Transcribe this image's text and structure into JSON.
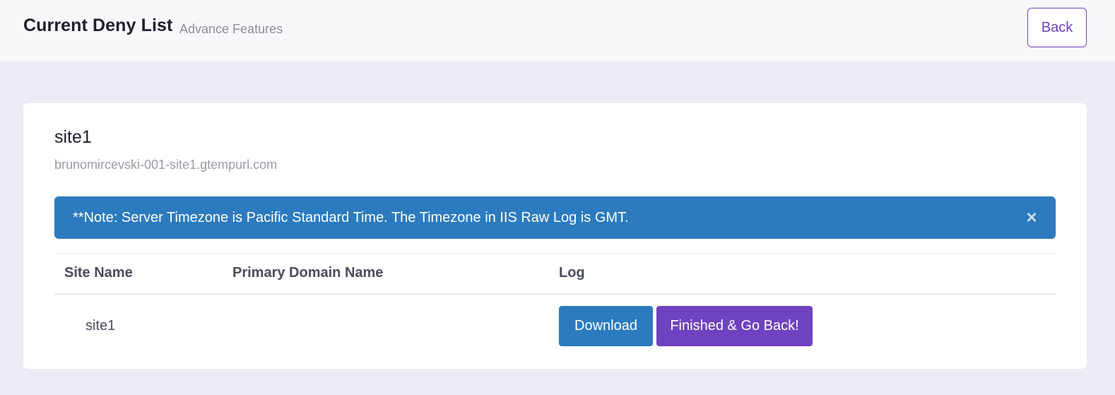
{
  "header": {
    "title": "Current Deny List",
    "subtitle": "Advance Features",
    "back_label": "Back"
  },
  "site": {
    "name": "site1",
    "url": "brunomircevski-001-site1.gtempurl.com"
  },
  "alert": {
    "text": "**Note: Server Timezone is Pacific Standard Time. The Timezone in IIS Raw Log is GMT.",
    "close_glyph": "×"
  },
  "table": {
    "columns": [
      "Site Name",
      "Primary Domain Name",
      "Log"
    ],
    "rows": [
      {
        "site_name": "site1",
        "primary_domain": "",
        "download_label": "Download",
        "finish_label": "Finished & Go Back!"
      }
    ]
  },
  "colors": {
    "primary_blue": "#2c7bbf",
    "primary_purple": "#6f42c1",
    "background": "#ebecf5"
  }
}
